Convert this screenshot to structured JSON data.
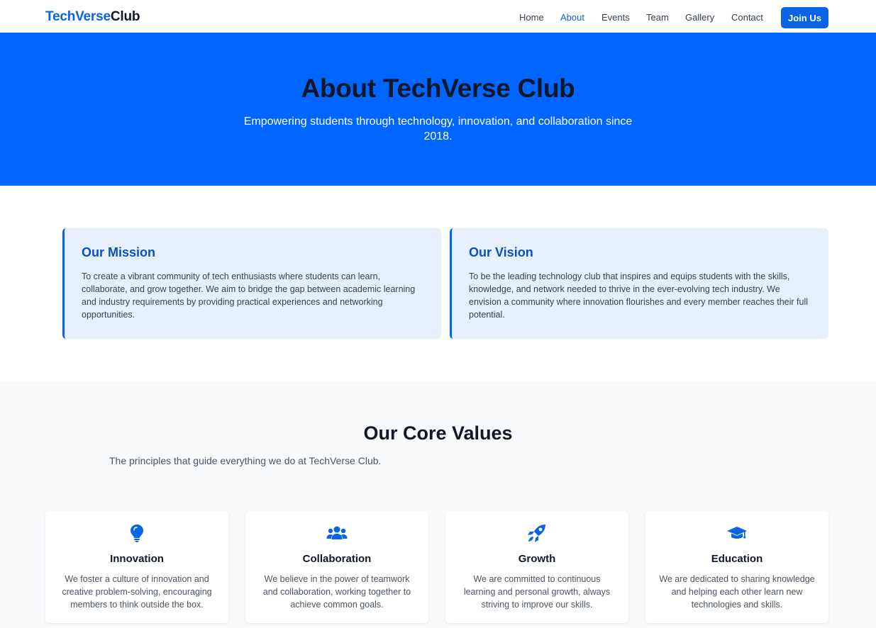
{
  "nav": {
    "brand_part1": "TechVerse",
    "brand_part2": "Club",
    "links": [
      "Home",
      "About",
      "Events",
      "Team",
      "Gallery",
      "Contact"
    ],
    "active": "About",
    "join_label": "Join Us"
  },
  "hero": {
    "title": "About TechVerse Club",
    "subtitle": "Empowering students through technology, innovation, and collaboration since 2018."
  },
  "mission": {
    "title": "Our Mission",
    "text": "To create a vibrant community of tech enthusiasts where students can learn, collaborate, and grow together. We aim to bridge the gap between academic learning and industry requirements by providing practical experiences and networking opportunities."
  },
  "vision": {
    "title": "Our Vision",
    "text": "To be the leading technology club that inspires and equips students with the skills, knowledge, and network needed to thrive in the ever-evolving tech industry. We envision a community where innovation flourishes and every member reaches their full potential."
  },
  "values": {
    "title": "Our Core Values",
    "subtitle": "The principles that guide everything we do at TechVerse Club.",
    "items": [
      {
        "icon": "lightbulb-icon",
        "title": "Innovation",
        "text": "We foster a culture of innovation and creative problem-solving, encouraging members to think outside the box."
      },
      {
        "icon": "users-icon",
        "title": "Collaboration",
        "text": "We believe in the power of teamwork and collaboration, working together to achieve common goals."
      },
      {
        "icon": "rocket-icon",
        "title": "Growth",
        "text": "We are committed to continuous learning and personal growth, always striving to improve our skills."
      },
      {
        "icon": "graduation-cap-icon",
        "title": "Education",
        "text": "We are dedicated to sharing knowledge and helping each other learn new technologies and skills."
      }
    ]
  },
  "colors": {
    "accent": "#0b63e5",
    "hero_bg": "#0066ff",
    "card_bg": "#e6f0fd"
  }
}
